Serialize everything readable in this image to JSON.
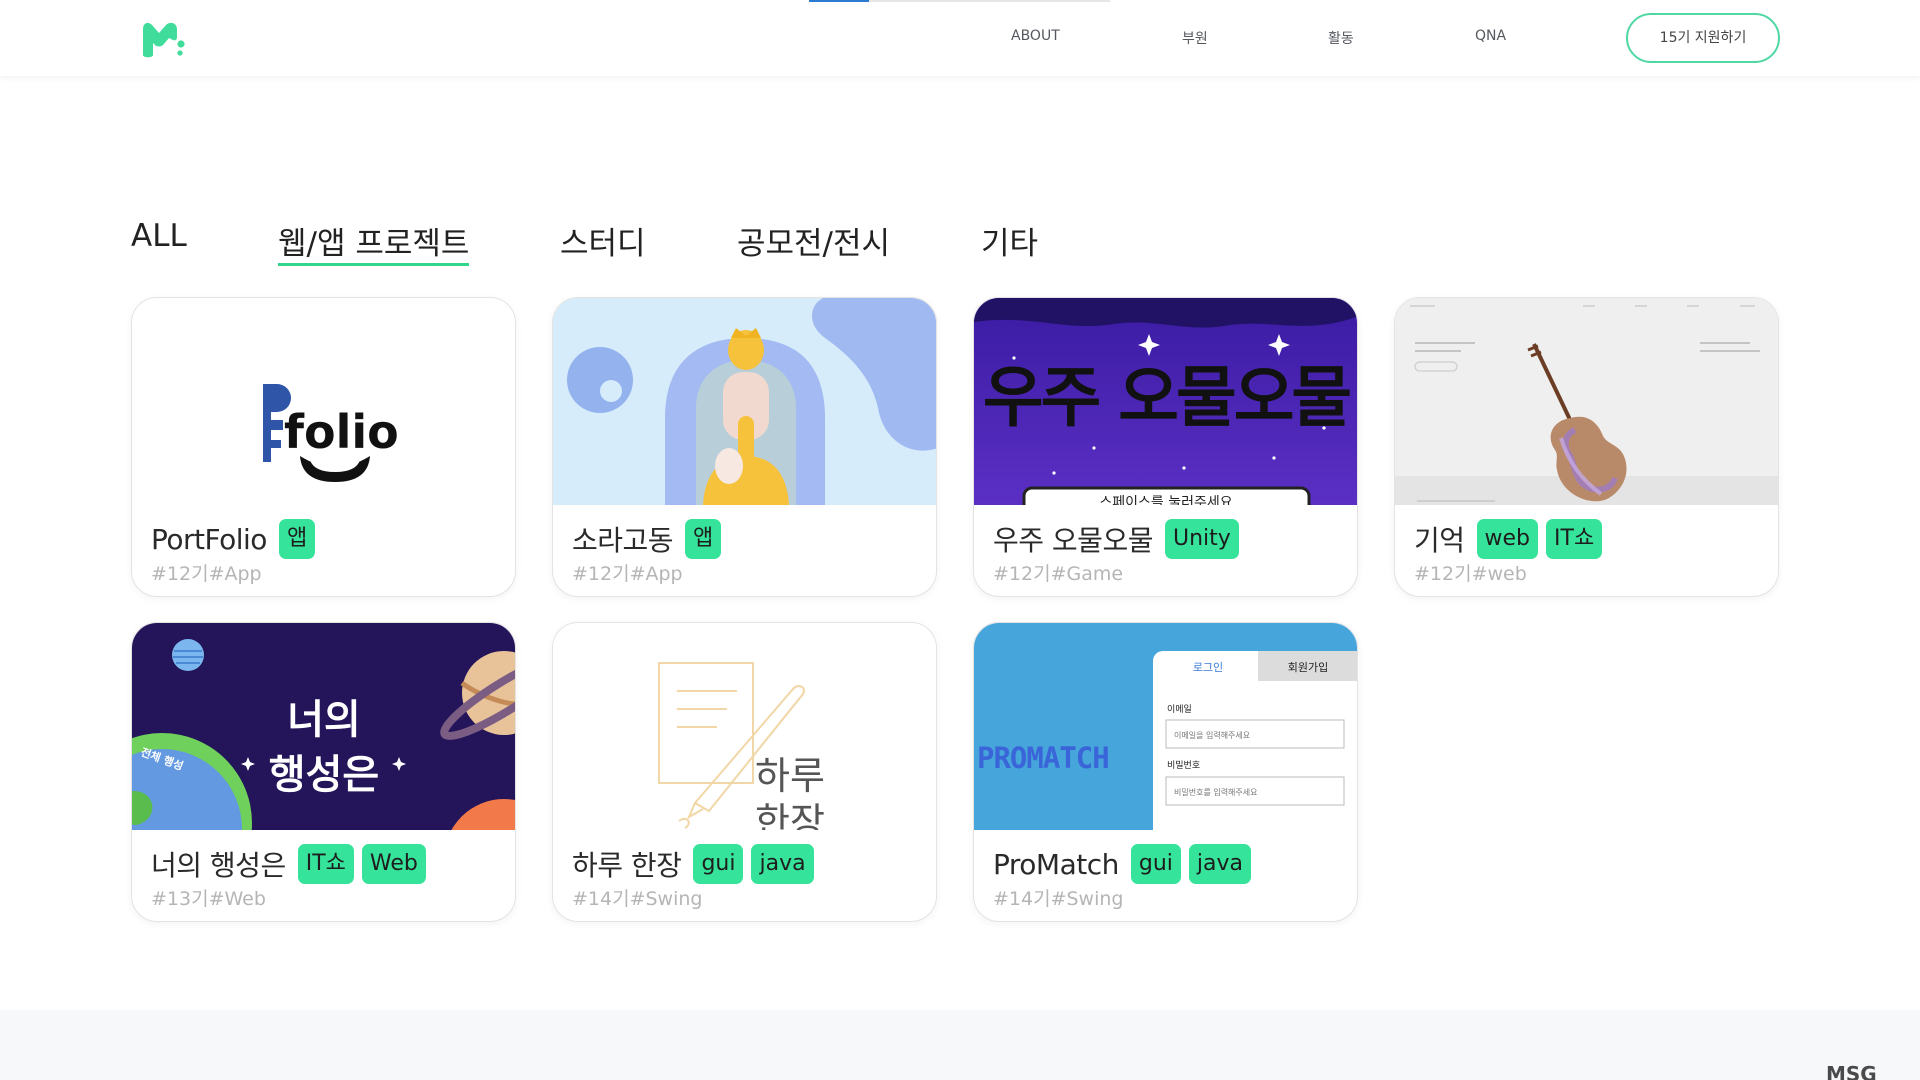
{
  "header": {
    "scroll_progress_percent": 20,
    "nav": [
      {
        "label": "ABOUT"
      },
      {
        "label": "부원"
      },
      {
        "label": "활동"
      },
      {
        "label": "QNA"
      }
    ],
    "apply_button": "15기 지원하기",
    "brand_color": "#3fdc9b"
  },
  "tabs": [
    {
      "label": "ALL",
      "active": false
    },
    {
      "label": "웹/앱 프로젝트",
      "active": true
    },
    {
      "label": "스터디",
      "active": false
    },
    {
      "label": "공모전/전시",
      "active": false
    },
    {
      "label": "기타",
      "active": false
    }
  ],
  "projects": [
    {
      "title": "PortFolio",
      "tags": [
        "앱"
      ],
      "meta": "#12기#App",
      "thumb": "portfolio-logo",
      "thumb_text": "folio"
    },
    {
      "title": "소라고동",
      "tags": [
        "앱"
      ],
      "meta": "#12기#App",
      "thumb": "conch-illustration"
    },
    {
      "title": "우주 오물오물",
      "tags": [
        "Unity"
      ],
      "meta": "#12기#Game",
      "thumb": "space-game-banner",
      "thumb_text": "우주 오물오물",
      "thumb_subtext": "스페이스를 눌러주세요"
    },
    {
      "title": "기억",
      "tags": [
        "web",
        "IT쇼"
      ],
      "meta": "#12기#web",
      "thumb": "violin-website"
    },
    {
      "title": "너의 행성은",
      "tags": [
        "IT쇼",
        "Web"
      ],
      "meta": "#13기#Web",
      "thumb": "planet-banner",
      "thumb_text_line1": "너의",
      "thumb_text_line2": "행성은",
      "thumb_side_text": "전체 행성"
    },
    {
      "title": "하루 한장",
      "tags": [
        "gui",
        "java"
      ],
      "meta": "#14기#Swing",
      "thumb": "diary-illustration",
      "thumb_text_line1": "하루",
      "thumb_text_line2": "한장"
    },
    {
      "title": "ProMatch",
      "tags": [
        "gui",
        "java"
      ],
      "meta": "#14기#Swing",
      "thumb": "login-form-screenshot",
      "thumb_brand": "PROMATCH",
      "thumb_tabs": [
        "로그인",
        "회원가입"
      ],
      "thumb_field1_label": "이메일",
      "thumb_field1_placeholder": "이메일을 입력해주세요",
      "thumb_field2_label": "비밀번호",
      "thumb_field2_placeholder": "비밀번호를 입력해주세요"
    }
  ],
  "footer": {
    "text": "MSG"
  }
}
